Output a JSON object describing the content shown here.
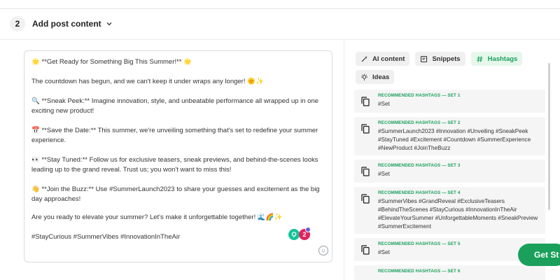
{
  "step": {
    "number": "2",
    "title": "Add post content"
  },
  "editor": {
    "lines": [
      "🌟 **Get Ready for Something Big This Summer!** 🌟",
      "The countdown has begun, and we can't keep it under wraps any longer! 🌞✨",
      "🔍 **Sneak Peek:** Imagine innovation, style, and unbeatable performance all wrapped up in one exciting new product!",
      "📅 **Save the Date:** This summer, we're unveiling something that's set to redefine your summer experience.",
      "👀 **Stay Tuned:** Follow us for exclusive teasers, sneak previews, and behind-the-scenes looks leading up to the grand reveal. Trust us; you won't want to miss this!",
      "👋 **Join the Buzz:** Use #SummerLaunch2023 to share your guesses and excitement as the big day approaches!",
      "Are you ready to elevate your summer? Let's make it unforgettable together! 🌊🌈✨",
      "#StayCurious #SummerVibes #InnovationInTheAir"
    ],
    "grammarly_badge": "2"
  },
  "panel": {
    "tabs": [
      {
        "label": "AI content",
        "icon": "magic-wand-icon",
        "active": false
      },
      {
        "label": "Snippets",
        "icon": "snippet-icon",
        "active": false
      },
      {
        "label": "Hashtags",
        "icon": "hash-icon",
        "active": true
      },
      {
        "label": "Ideas",
        "icon": "lightbulb-icon",
        "active": false
      }
    ],
    "sets": [
      {
        "title": "RECOMMENDED HASHTAGS — SET 1",
        "tags": "#Set"
      },
      {
        "title": "RECOMMENDED HASHTAGS — SET 2",
        "tags": "#SummerLaunch2023 #Innovation #Unveiling #SneakPeek #StayTuned #Excitement #Countdown #SummerExperience #NewProduct #JoinTheBuzz"
      },
      {
        "title": "RECOMMENDED HASHTAGS — SET 3",
        "tags": "#Set"
      },
      {
        "title": "RECOMMENDED HASHTAGS — SET 4",
        "tags": "#SummerVibes #GrandReveal #ExclusiveTeasers #BehindTheScenes #StayCurious #InnovationInTheAir #ElevateYourSummer #UnforgettableMoments #SneakPreview #SummerExcitement"
      },
      {
        "title": "RECOMMENDED HASHTAGS — SET 5",
        "tags": "#Set"
      },
      {
        "title": "RECOMMENDED HASHTAGS — SET 6",
        "tags": ""
      }
    ]
  },
  "cta": {
    "label": "Get St"
  },
  "colors": {
    "accent": "#1aa05b",
    "accent_bg": "#e6f7ec"
  }
}
